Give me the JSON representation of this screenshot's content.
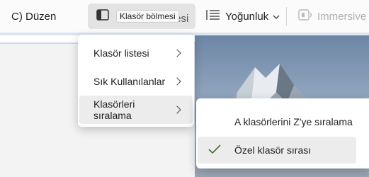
{
  "ribbon": {
    "edit_label": "C) Düzen",
    "pane_label_hidden": "Klasör bölmesi",
    "pane_tooltip": "Klasör bölmesi",
    "density_label": "Yoğunluk",
    "immersive_label": "Immersive"
  },
  "menu": {
    "items": [
      {
        "label": "Klasör listesi"
      },
      {
        "label": "Sık Kullanılanlar"
      },
      {
        "label": "Klasörleri sıralama"
      }
    ]
  },
  "submenu": {
    "items": [
      {
        "label": "A klasörlerini Z'ye sıralama"
      },
      {
        "label": "Özel klasör sırası"
      }
    ]
  },
  "icons": {
    "pane": "folder-pane-icon",
    "density": "density-icon",
    "immersive": "immersive-reader-icon",
    "check": "checkmark-icon"
  },
  "colors": {
    "check": "#4b7a2f",
    "hover": "#ececec",
    "pane_button": "#e3e3e3"
  }
}
